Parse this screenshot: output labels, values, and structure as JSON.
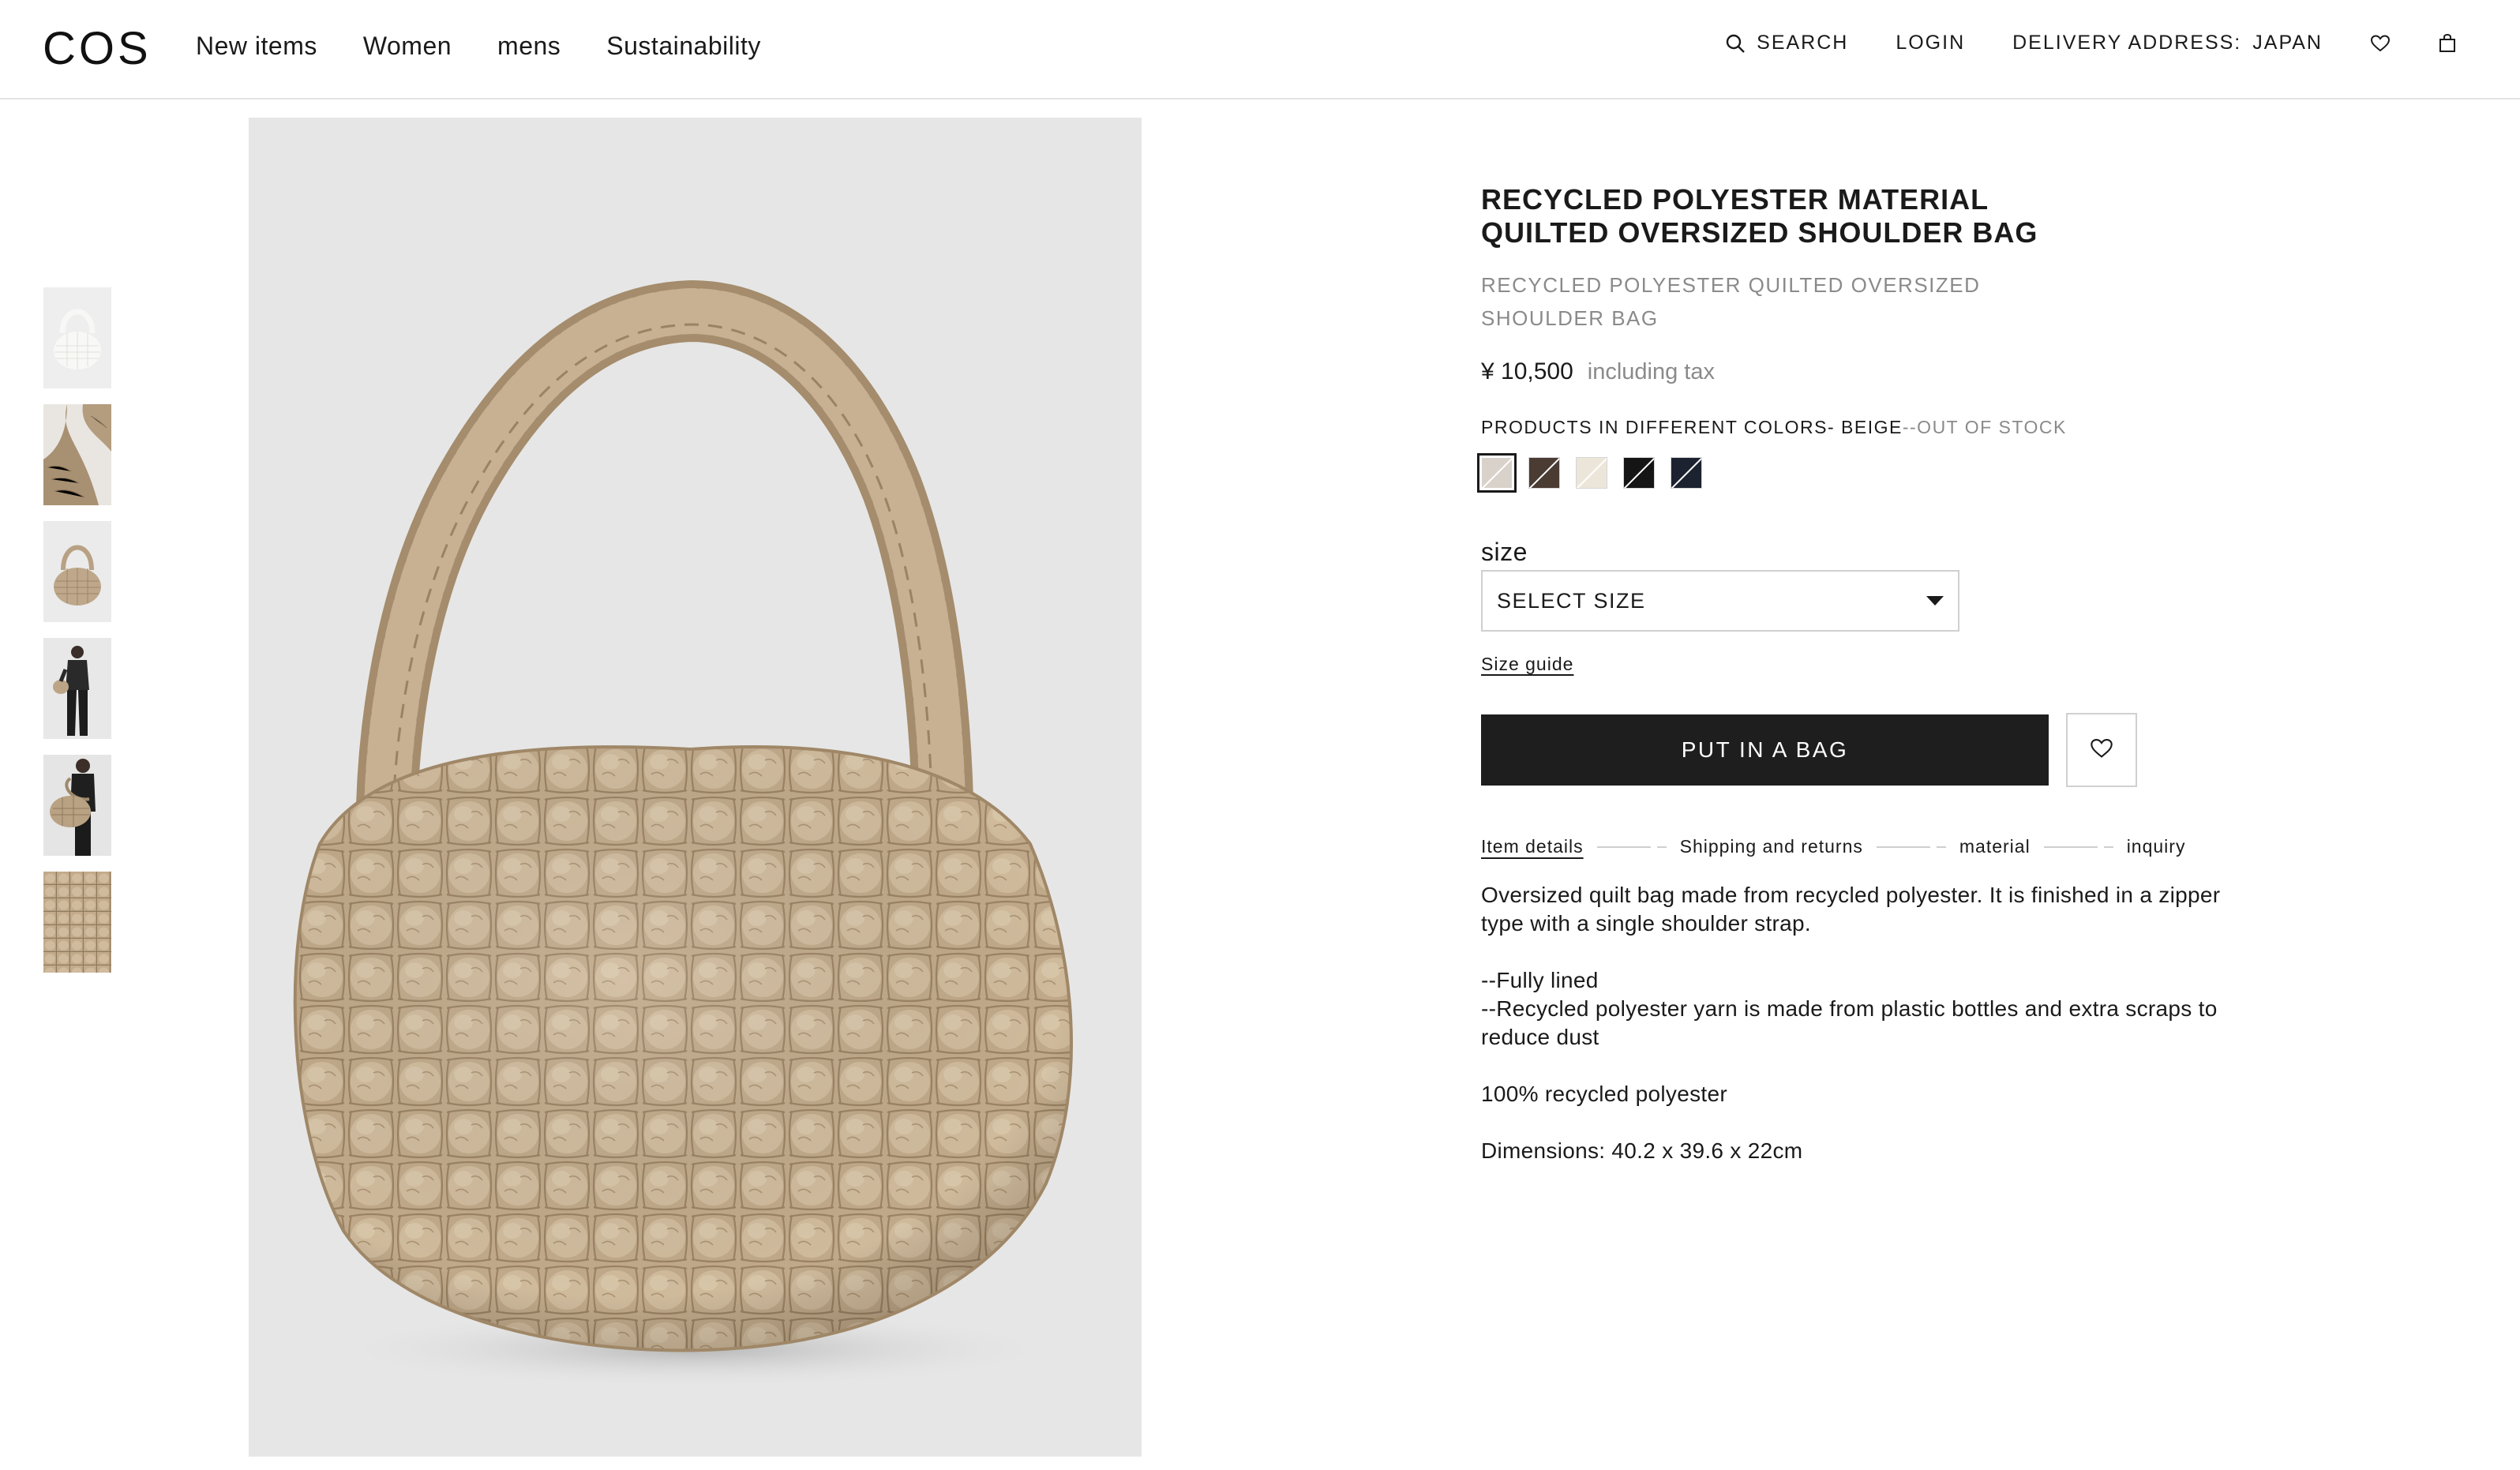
{
  "header": {
    "logo": "COS",
    "nav": [
      "New items",
      "Women",
      "mens",
      "Sustainability"
    ],
    "search_label": "SEARCH",
    "login_label": "LOGIN",
    "delivery_label": "DELIVERY ADDRESS:",
    "delivery_value": "JAPAN"
  },
  "gallery": {
    "thumbnails": [
      "bag-white",
      "bag-detail-handle",
      "bag-beige",
      "model-front",
      "model-carrying",
      "quilt-texture"
    ],
    "main_color": "#c3ad91"
  },
  "product": {
    "title": "RECYCLED POLYESTER MATERIAL QUILTED OVERSIZED SHOULDER BAG",
    "subtitle": "RECYCLED POLYESTER QUILTED OVERSIZED SHOULDER BAG",
    "price": "¥ 10,500",
    "tax_note": "including tax",
    "colors_label": "PRODUCTS IN DIFFERENT COLORS- BEIGE",
    "stock_status": "--OUT OF STOCK",
    "swatches": [
      {
        "name": "beige",
        "color": "#d9d2ca",
        "selected": true
      },
      {
        "name": "brown",
        "color": "#4a3b33",
        "selected": false
      },
      {
        "name": "off-white",
        "color": "#ece6da",
        "selected": false
      },
      {
        "name": "black",
        "color": "#151515",
        "selected": false
      },
      {
        "name": "navy",
        "color": "#1c2230",
        "selected": false
      }
    ],
    "size_label": "size",
    "size_select": "SELECT SIZE",
    "size_guide": "Size guide",
    "add_to_bag": "PUT IN A BAG",
    "tabs": [
      "Item details",
      "Shipping and returns",
      "material",
      "inquiry"
    ],
    "description": {
      "intro": "Oversized quilt bag made from recycled polyester. It is finished in a zipper type with a single shoulder strap.",
      "bullet_1": "--Fully lined",
      "bullet_2": "--Recycled polyester yarn is made from plastic bottles and extra scraps to reduce dust",
      "composition": "100% recycled polyester",
      "dimensions": "Dimensions: 40.2 x 39.6 x 22cm"
    }
  }
}
